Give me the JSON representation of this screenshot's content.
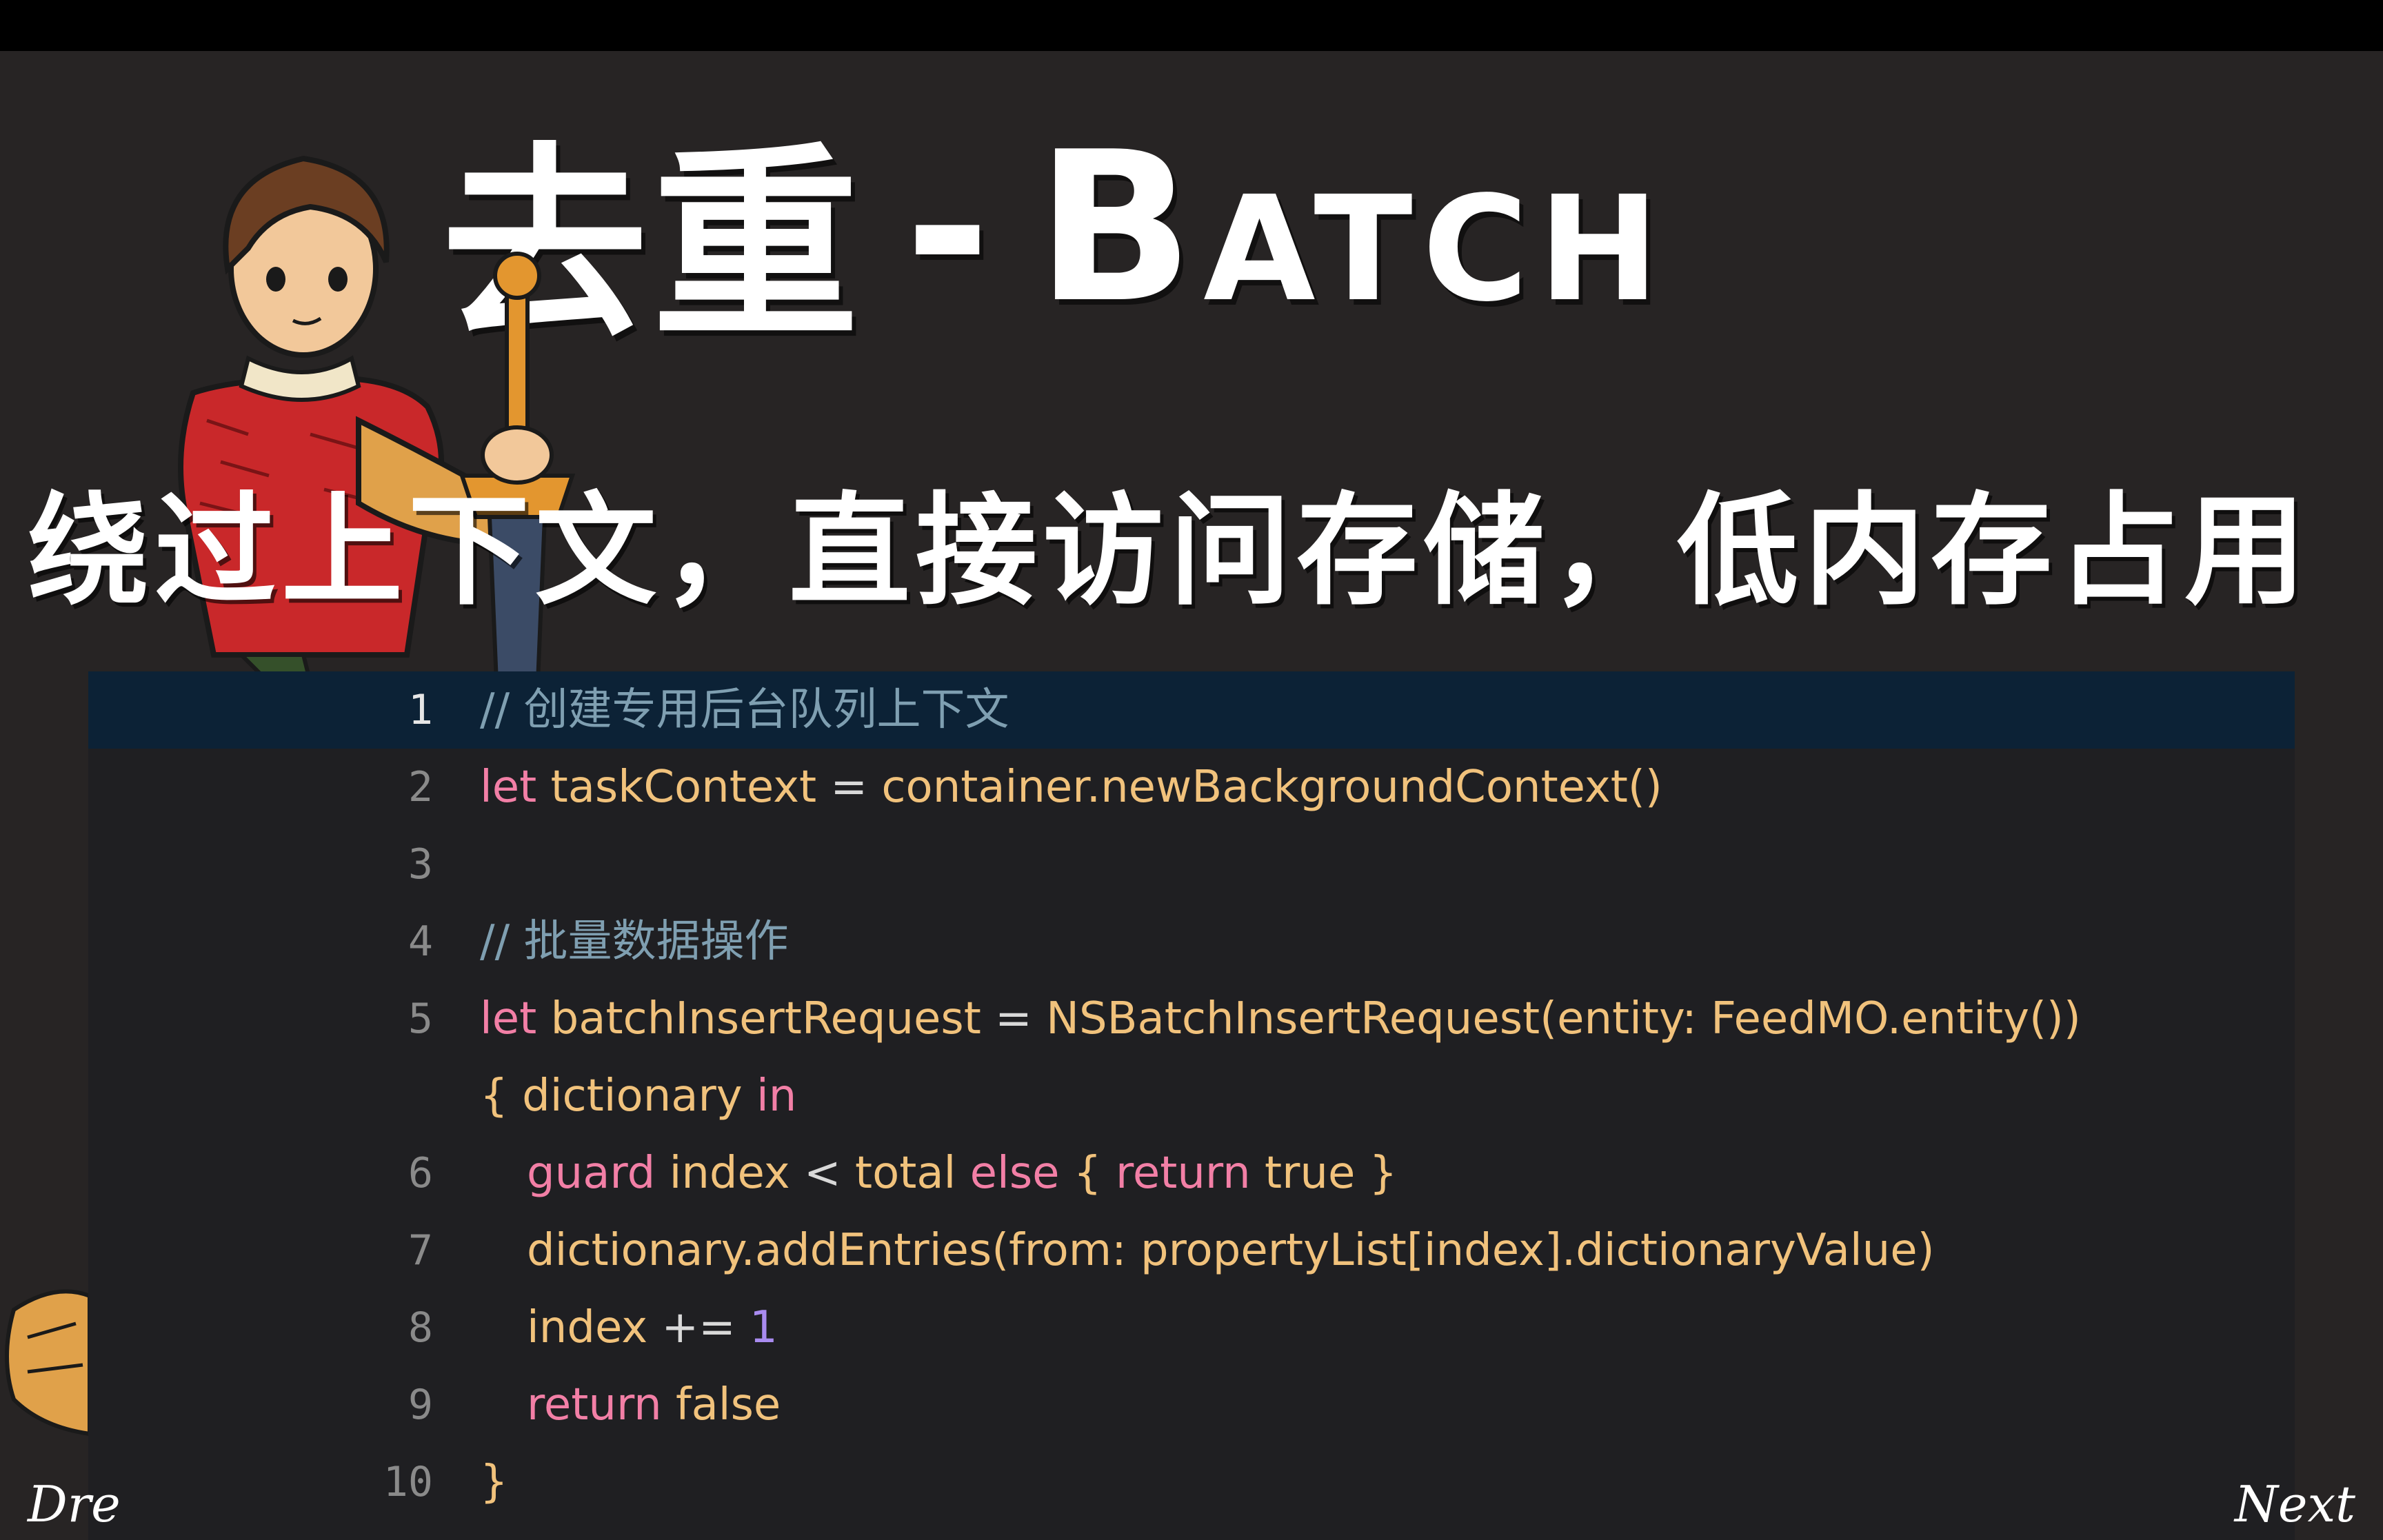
{
  "slide": {
    "title_cn": "去重",
    "title_sep": "-",
    "title_en": "Batch",
    "subtitle": "绕过上下文，直接访问存储，低内存占用"
  },
  "code": {
    "lines": [
      {
        "num": "1",
        "tokens": [
          {
            "t": "// 创建专用后台队列上下文",
            "c": "cm"
          }
        ]
      },
      {
        "num": "2",
        "tokens": [
          {
            "t": "let",
            "c": "kw"
          },
          {
            "t": " taskContext ",
            "c": "pl"
          },
          {
            "t": "=",
            "c": "punct"
          },
          {
            "t": " container.newBackgroundContext()",
            "c": "fn"
          }
        ]
      },
      {
        "num": "3",
        "tokens": []
      },
      {
        "num": "4",
        "tokens": [
          {
            "t": "// 批量数据操作",
            "c": "cm"
          }
        ]
      },
      {
        "num": "5",
        "tokens": [
          {
            "t": "let",
            "c": "kw"
          },
          {
            "t": " batchInsertRequest ",
            "c": "pl"
          },
          {
            "t": "=",
            "c": "punct"
          },
          {
            "t": " NSBatchInsertRequest(entity: FeedMO.entity())",
            "c": "fn"
          }
        ]
      },
      {
        "num": "",
        "tokens": [
          {
            "t": "{ dictionary ",
            "c": "pl"
          },
          {
            "t": "in",
            "c": "kw"
          }
        ]
      },
      {
        "num": "6",
        "indent": true,
        "tokens": [
          {
            "t": "guard",
            "c": "kw"
          },
          {
            "t": " index ",
            "c": "pl"
          },
          {
            "t": "<",
            "c": "punct"
          },
          {
            "t": " total ",
            "c": "pl"
          },
          {
            "t": "else",
            "c": "kw"
          },
          {
            "t": " { ",
            "c": "pl"
          },
          {
            "t": "return",
            "c": "kw"
          },
          {
            "t": " true }",
            "c": "pl"
          }
        ]
      },
      {
        "num": "7",
        "indent": true,
        "tokens": [
          {
            "t": "dictionary.addEntries(from: propertyList[index].dictionaryValue)",
            "c": "fn"
          }
        ]
      },
      {
        "num": "8",
        "indent": true,
        "tokens": [
          {
            "t": "index ",
            "c": "pl"
          },
          {
            "t": "+=",
            "c": "punct"
          },
          {
            "t": " ",
            "c": "pl"
          },
          {
            "t": "1",
            "c": "num"
          }
        ]
      },
      {
        "num": "9",
        "indent": true,
        "tokens": [
          {
            "t": "return",
            "c": "kw"
          },
          {
            "t": " false",
            "c": "pl"
          }
        ]
      },
      {
        "num": "10",
        "tokens": [
          {
            "t": "}",
            "c": "pl"
          }
        ]
      }
    ],
    "highlighted_line": "1"
  },
  "footer": {
    "left_nav": "Dre",
    "right_nav": "Next"
  },
  "colors": {
    "background": "#272424",
    "panel": "#1f1f22",
    "highlight": "#0c2236",
    "comment": "#7f9fb1",
    "keyword": "#f27fa6",
    "plain": "#f1c27c",
    "number": "#a98bf0"
  },
  "icons": {
    "mascot": "knight-with-sword-illustration",
    "corner_hand": "cartoon-hand-illustration"
  }
}
